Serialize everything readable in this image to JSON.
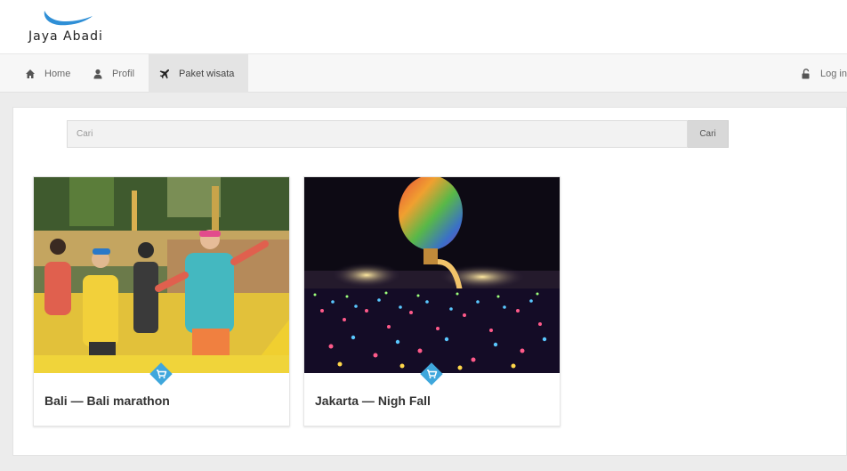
{
  "brand": {
    "name": "Jaya Abadi",
    "logo_color": "#2f8fd6"
  },
  "nav": {
    "items": [
      {
        "label": "Home",
        "icon": "home-icon"
      },
      {
        "label": "Profil",
        "icon": "user-icon"
      },
      {
        "label": "Paket wisata",
        "icon": "plane-icon",
        "active": true
      }
    ],
    "login": {
      "label": "Log in",
      "icon": "unlock-icon"
    }
  },
  "search": {
    "placeholder": "Cari",
    "button_label": "Cari"
  },
  "cards": [
    {
      "title": "Bali — Bali marathon",
      "image": "bali-marathon-photo",
      "badge_icon": "cart-icon"
    },
    {
      "title": "Jakarta — Nigh Fall",
      "image": "night-lantern-festival-photo",
      "badge_icon": "cart-icon"
    }
  ],
  "colors": {
    "badge": "#3fa7dc",
    "accent": "#2f8fd6"
  }
}
